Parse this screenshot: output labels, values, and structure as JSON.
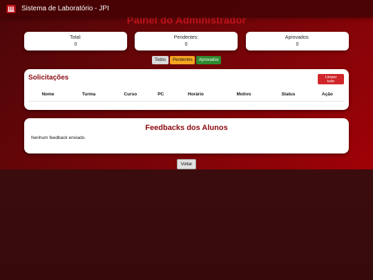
{
  "app": {
    "title": "Sistema de Laboratório - JPI",
    "logo_icon": "jpi-logo-icon"
  },
  "page": {
    "heading": "Painel do Administrador"
  },
  "stats": [
    {
      "label": "Total:",
      "value": "0"
    },
    {
      "label": "Pendentes:",
      "value": "0"
    },
    {
      "label": "Aprovados:",
      "value": "0"
    }
  ],
  "filters": {
    "all": "Todos",
    "pending": "Pendentes",
    "approved": "Aprovados"
  },
  "requests": {
    "title": "Solicitações",
    "clear_button": "Limpar tudo",
    "columns": [
      "Nome",
      "Turma",
      "Curso",
      "PC",
      "Horário",
      "Motivo",
      "Status",
      "Ação"
    ],
    "rows": []
  },
  "feedback": {
    "title": "Feedbacks dos Alunos",
    "empty": "Nenhum feedback enviado."
  },
  "back_button": "Voltar",
  "colors": {
    "accent": "#8b0a10",
    "pending": "#f5a524",
    "approved": "#2f8a2f",
    "danger": "#d0262a"
  }
}
